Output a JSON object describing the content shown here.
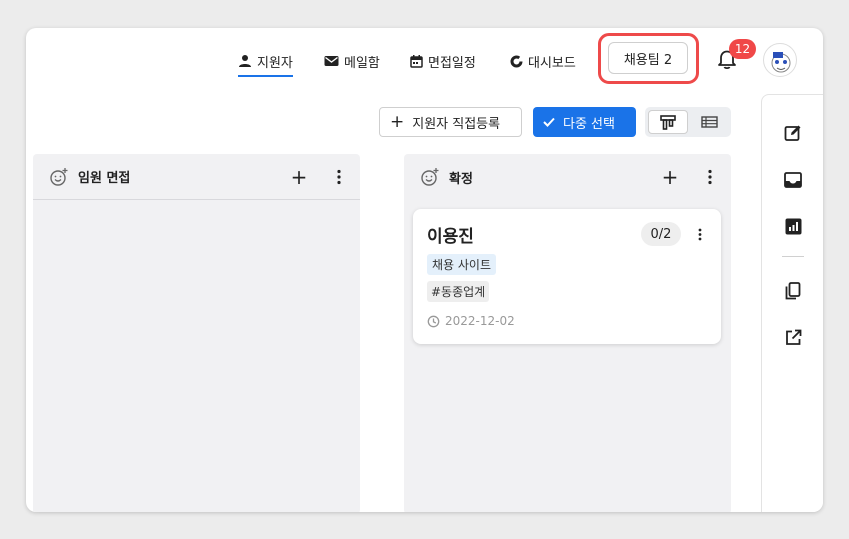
{
  "nav": {
    "applicants": "지원자",
    "mailbox": "메일함",
    "interview_schedule": "면접일정",
    "dashboard": "대시보드"
  },
  "team_button": "채용팀 2",
  "notifications": {
    "count": "12"
  },
  "toolbar": {
    "register_label": "지원자 직접등록",
    "multi_select_label": "다중 선택"
  },
  "columns": [
    {
      "title": "임원 면접"
    },
    {
      "title": "확정"
    }
  ],
  "card": {
    "name": "이용진",
    "count": "0/2",
    "source_tag": "채용 사이트",
    "hash_tag": "#동종업계",
    "date": "2022-12-02"
  },
  "colors": {
    "accent": "#1a73e8",
    "badge": "#f04848",
    "highlight": "#ee4a4a",
    "column_bg": "#f1f1f3"
  }
}
